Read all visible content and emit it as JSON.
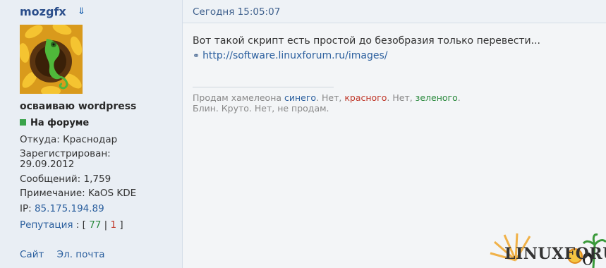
{
  "user": {
    "name": "mozgfx",
    "title": "осваиваю wordpress",
    "status": "На форуме",
    "status_color": "#3aa34a",
    "location": "Откуда: Краснодар",
    "registered_label": "Зарегистрирован:",
    "registered_date": "29.09.2012",
    "posts": "Сообщений: 1,759",
    "note": "Примечание: KaOS KDE",
    "ip_label": "IP:",
    "ip": "85.175.194.89",
    "reputation": {
      "label": "Репутация",
      "sep": " : [ ",
      "positive": "77",
      "divider": " | ",
      "negative": "1",
      "close": " ]"
    },
    "links": {
      "site": "Сайт",
      "email": "Эл. почта"
    }
  },
  "post": {
    "date": "Сегодня 15:05:07",
    "message": "Вот такой скрипт есть простой до безобразия только перевести...",
    "link": "http://software.linuxforum.ru/images/",
    "signature": {
      "part1": "Продам хамелеона ",
      "blue": "синего",
      "part2": ". Нет, ",
      "red": "красного",
      "part3": ". Нет, ",
      "green": "зеленого",
      "part4": ".",
      "line2": "Блин. Круто. Нет, не продам."
    }
  },
  "logo": {
    "text": "LINUXFORUM"
  },
  "colors": {
    "link": "#2b5f9e",
    "positive": "#2b8a3e",
    "negative": "#c0392b"
  }
}
